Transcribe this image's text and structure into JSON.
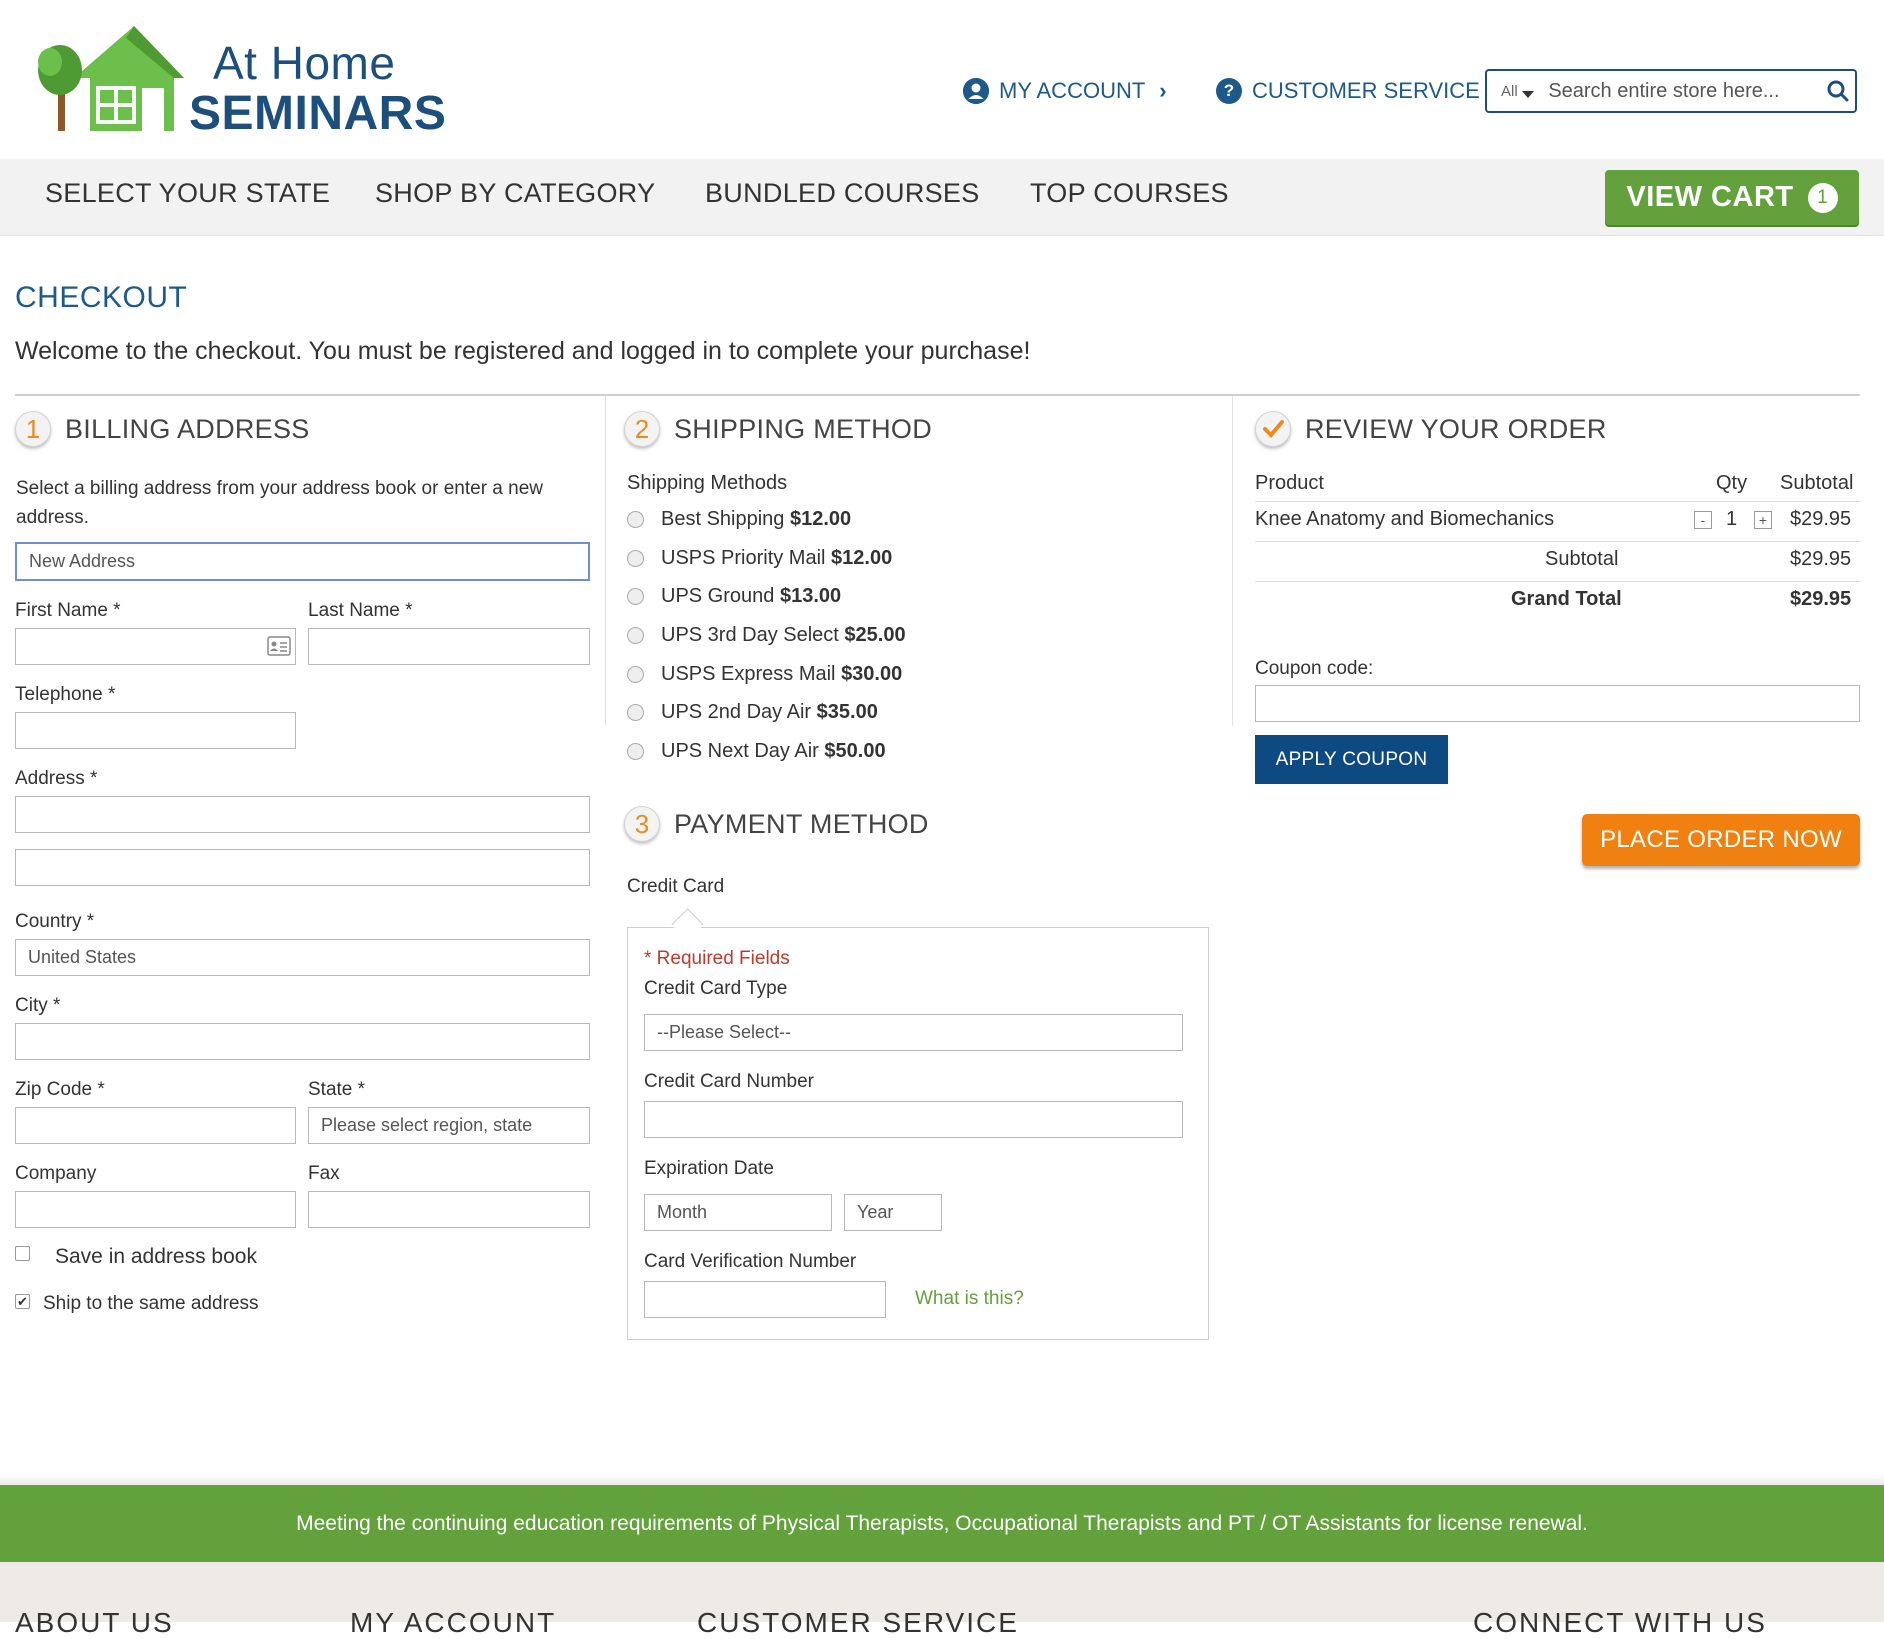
{
  "brand": {
    "line1": "At Home",
    "line2": "SEMINARS",
    "colors": {
      "green": "#62a13b",
      "navy": "#1d4f7c",
      "orange": "#f0800f"
    }
  },
  "header": {
    "my_account": "MY ACCOUNT",
    "customer_service": "CUSTOMER SERVICE",
    "search": {
      "category": "All",
      "placeholder": "Search entire store here..."
    }
  },
  "nav": {
    "items": [
      "SELECT YOUR STATE",
      "SHOP BY CATEGORY",
      "BUNDLED COURSES",
      "TOP COURSES"
    ],
    "view_cart": "VIEW CART",
    "cart_count": "1"
  },
  "page": {
    "title": "CHECKOUT",
    "welcome": "Welcome to the checkout. You must be registered and logged in to complete your purchase!"
  },
  "billing": {
    "step": "1",
    "title": "BILLING ADDRESS",
    "intro": "Select a billing address from your address book or enter a new address.",
    "address_select": "New Address",
    "first_name": "First Name *",
    "last_name": "Last Name *",
    "telephone": "Telephone *",
    "address": "Address *",
    "country": "Country *",
    "country_value": "United States",
    "city": "City *",
    "zip": "Zip Code *",
    "state": "State *",
    "state_value": "Please select region, state",
    "company": "Company",
    "fax": "Fax",
    "save_in_book": "Save in address book",
    "ship_same": "Ship to the same address"
  },
  "shipping": {
    "step": "2",
    "title": "SHIPPING METHOD",
    "subtitle": "Shipping Methods",
    "methods": [
      {
        "name": "Best Shipping",
        "price": "$12.00"
      },
      {
        "name": "USPS Priority Mail",
        "price": "$12.00"
      },
      {
        "name": "UPS Ground",
        "price": "$13.00"
      },
      {
        "name": "UPS 3rd Day Select",
        "price": "$25.00"
      },
      {
        "name": "USPS Express Mail",
        "price": "$30.00"
      },
      {
        "name": "UPS 2nd Day Air",
        "price": "$35.00"
      },
      {
        "name": "UPS Next Day Air",
        "price": "$50.00"
      }
    ]
  },
  "payment": {
    "step": "3",
    "title": "PAYMENT METHOD",
    "method": "Credit Card",
    "required": "* Required Fields",
    "cc_type": "Credit Card Type",
    "cc_type_value": "--Please Select--",
    "cc_number": "Credit Card Number",
    "expiration": "Expiration Date",
    "month": "Month",
    "year": "Year",
    "cvv": "Card Verification Number",
    "what_is_this": "What is this?"
  },
  "review": {
    "title": "REVIEW YOUR ORDER",
    "col_product": "Product",
    "col_qty": "Qty",
    "col_subtotal": "Subtotal",
    "item": {
      "name": "Knee Anatomy and Biomechanics",
      "qty": "1",
      "subtotal": "$29.95"
    },
    "subtotal_label": "Subtotal",
    "subtotal_value": "$29.95",
    "grand_total_label": "Grand Total",
    "grand_total_value": "$29.95",
    "coupon_label": "Coupon code:",
    "apply_coupon": "APPLY COUPON",
    "place_order": "PLACE ORDER NOW"
  },
  "footer": {
    "tagline": "Meeting the continuing education requirements of Physical Therapists, Occupational Therapists and PT / OT Assistants for license renewal.",
    "columns": [
      "ABOUT US",
      "MY ACCOUNT",
      "CUSTOMER SERVICE",
      "CONNECT WITH US"
    ]
  }
}
